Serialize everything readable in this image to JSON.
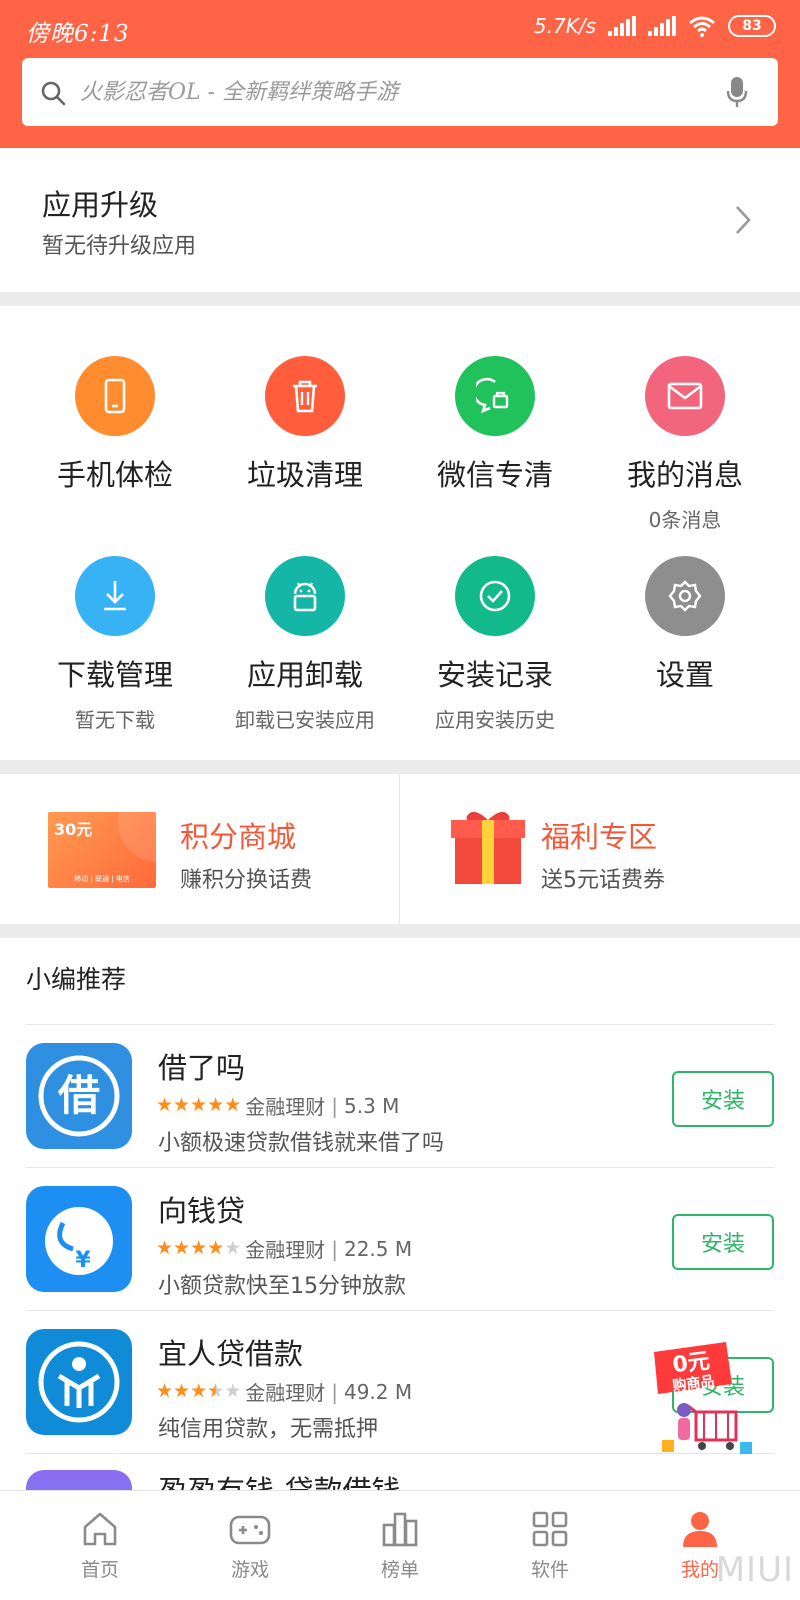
{
  "status": {
    "time": "傍晚6:13",
    "speed": "5.7K/s",
    "battery": "83"
  },
  "search": {
    "placeholder": "火影忍者OL - 全新羁绊策略手游",
    "icon": "search-icon",
    "mic_icon": "mic-icon"
  },
  "upgrade": {
    "title": "应用升级",
    "subtitle": "暂无待升级应用"
  },
  "tools": [
    {
      "label": "手机体检",
      "sub": "",
      "icon": "phone-icon",
      "color": "#ff8c2e"
    },
    {
      "label": "垃圾清理",
      "sub": "",
      "icon": "trash-icon",
      "color": "#ff5d3b"
    },
    {
      "label": "微信专清",
      "sub": "",
      "icon": "wechat-clean-icon",
      "color": "#21c25b"
    },
    {
      "label": "我的消息",
      "sub": "0条消息",
      "icon": "mail-icon",
      "color": "#f2657d"
    },
    {
      "label": "下载管理",
      "sub": "暂无下载",
      "icon": "download-icon",
      "color": "#36b2f5"
    },
    {
      "label": "应用卸载",
      "sub": "卸载已安装应用",
      "icon": "android-icon",
      "color": "#16b6a7"
    },
    {
      "label": "安装记录",
      "sub": "应用安装历史",
      "icon": "check-circle-icon",
      "color": "#12b98a"
    },
    {
      "label": "设置",
      "sub": "",
      "icon": "gear-icon",
      "color": "#8e8e8e"
    }
  ],
  "promo": {
    "points": {
      "title": "积分商城",
      "subtitle": "赚积分换话费",
      "voucher_value": "30元",
      "voucher_foot": "移动 | 联通 | 电信"
    },
    "welfare": {
      "title": "福利专区",
      "subtitle": "送5元话费券"
    }
  },
  "recommend": {
    "title": "小编推荐",
    "install_label": "安装",
    "apps": [
      {
        "name": "借了吗",
        "rating": 5,
        "category": "金融理财",
        "size": "5.3 M",
        "desc": "小额极速贷款借钱就来借了吗"
      },
      {
        "name": "向钱贷",
        "rating": 4,
        "category": "金融理财",
        "size": "22.5 M",
        "desc": "小额贷款快至15分钟放款"
      },
      {
        "name": "宜人贷借款",
        "rating": 3.5,
        "category": "金融理财",
        "size": "49.2 M",
        "desc": "纯信用贷款，无需抵押"
      },
      {
        "name": "盈盈有钱-贷款借钱",
        "rating": 0,
        "category": "",
        "size": "",
        "desc": ""
      }
    ]
  },
  "float_promo": {
    "text_top": "0元",
    "text_bottom": "购商品"
  },
  "nav": [
    {
      "label": "首页",
      "icon": "home-icon"
    },
    {
      "label": "游戏",
      "icon": "gamepad-icon"
    },
    {
      "label": "榜单",
      "icon": "ranking-icon"
    },
    {
      "label": "软件",
      "icon": "apps-grid-icon"
    },
    {
      "label": "我的",
      "icon": "person-icon",
      "active": true
    }
  ],
  "watermark": "MIUI"
}
